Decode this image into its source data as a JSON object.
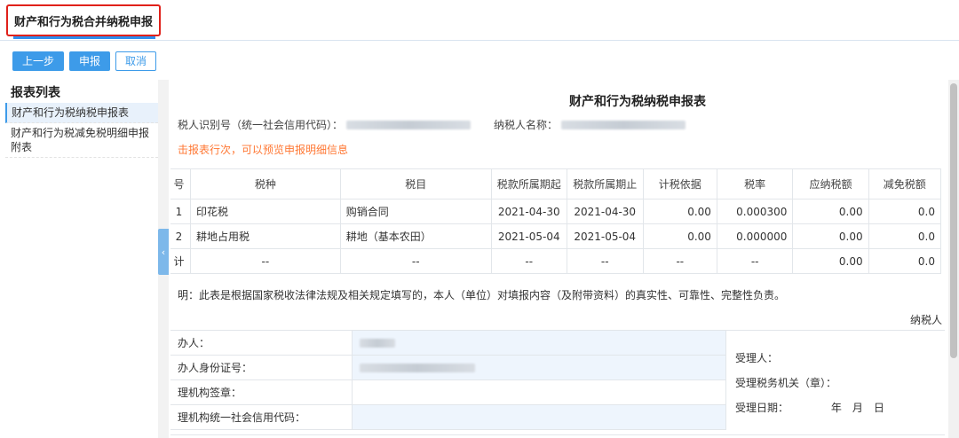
{
  "tab": {
    "label": "财产和行为税合并纳税申报"
  },
  "toolbar": {
    "prev_label": "上一步",
    "submit_label": "申报",
    "cancel_label": "取消"
  },
  "sidebar": {
    "title": "报表列表",
    "items": [
      {
        "label": "财产和行为税纳税申报表"
      },
      {
        "label": "财产和行为税减免税明细申报附表"
      }
    ],
    "collapse_icon": "chevron-left-icon"
  },
  "form": {
    "title": "财产和行为税纳税申报表",
    "taxpayer_id_label": "税人识别号（统一社会信用代码）：",
    "taxpayer_name_label": "纳税人名称：",
    "hint": "击报表行次，可以预览申报明细信息",
    "columns": [
      "号",
      "税种",
      "税目",
      "税款所属期起",
      "税款所属期止",
      "计税依据",
      "税率",
      "应纳税额",
      "减免税额"
    ],
    "rows": [
      {
        "no": "1",
        "tax_type": "印花税",
        "item": "购销合同",
        "start": "2021-04-30",
        "end": "2021-04-30",
        "basis": "0.00",
        "rate": "0.000300",
        "payable": "0.00",
        "relief": "0.0"
      },
      {
        "no": "2",
        "tax_type": "耕地占用税",
        "item": "耕地（基本农田）",
        "start": "2021-05-04",
        "end": "2021-05-04",
        "basis": "0.00",
        "rate": "0.000000",
        "payable": "0.00",
        "relief": "0.0"
      }
    ],
    "total": {
      "no": "计",
      "tax_type": "--",
      "item": "--",
      "start": "--",
      "end": "--",
      "basis": "--",
      "rate": "--",
      "payable": "0.00",
      "relief": "0.0"
    },
    "statement": "明：此表是根据国家税收法律法规及相关规定填写的，本人（单位）对填报内容（及附带资料）的真实性、可靠性、完整性负责。",
    "taxpayer_sign": "纳税人",
    "sign_rows": [
      {
        "label": "办人："
      },
      {
        "label": "办人身份证号："
      },
      {
        "label": "理机构签章："
      },
      {
        "label": "理机构统一社会信用代码："
      }
    ],
    "accept": {
      "person": "受理人：",
      "office": "受理税务机关（章）：",
      "date": "受理日期：",
      "date_parts": "年　月　日"
    }
  }
}
